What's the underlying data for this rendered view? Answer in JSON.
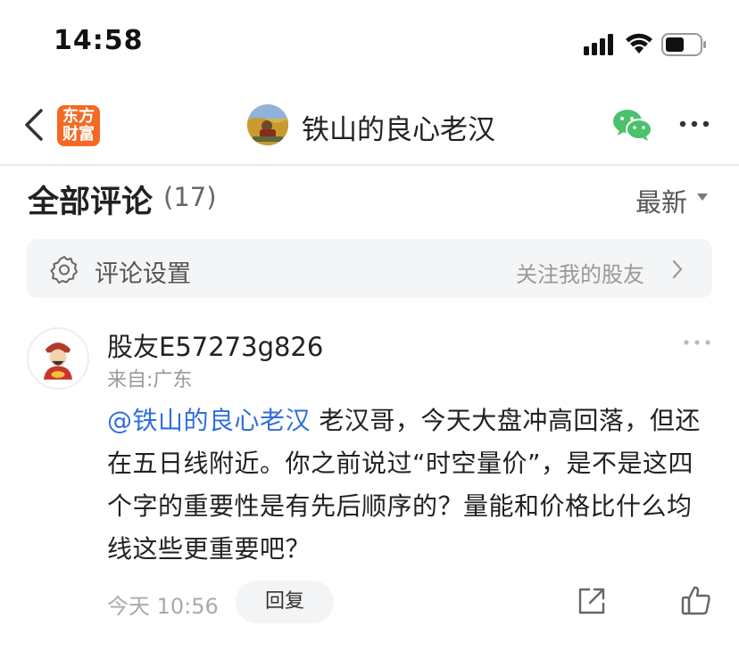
{
  "status_bar": {
    "time": "14:58"
  },
  "nav": {
    "logo_line1": "东方",
    "logo_line2": "财富",
    "title": "铁山的良心老汉",
    "icons": [
      "back-icon",
      "wechat-icon",
      "more-icon"
    ]
  },
  "comments_header": {
    "title": "全部评论",
    "count": "(17)",
    "sort_label": "最新"
  },
  "settings_bar": {
    "label": "评论设置",
    "follow_label": "关注我的股友"
  },
  "comment": {
    "username": "股友E57273g826",
    "location": "来自:广东",
    "mention": "@铁山的良心老汉",
    "text": " 老汉哥，今天大盘冲高回落，但还在五日线附近。你之前说过“时空量价”，是不是这四个字的重要性是有先后顺序的？量能和价格比什么均线这些更重要吧？",
    "time": "今天 10:56",
    "reply_label": "回复"
  },
  "colors": {
    "brand_orange": "#f36a25",
    "mention_blue": "#2f6fdc",
    "wechat_green": "#4bc16b"
  }
}
